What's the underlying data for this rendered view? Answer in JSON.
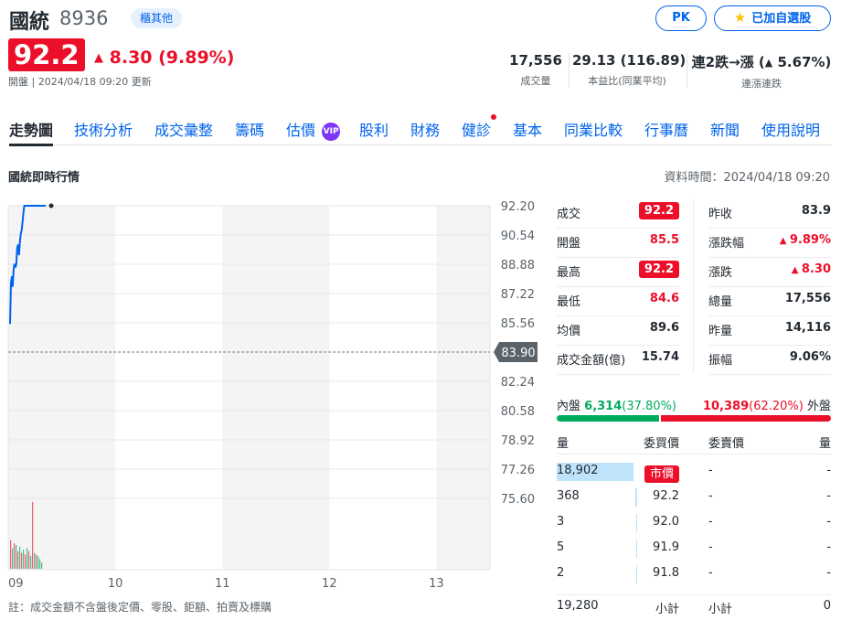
{
  "header": {
    "name": "國統",
    "code": "8936",
    "market": "櫃其他",
    "pk_label": "PK",
    "watch_label": "已加自選股",
    "price": "92.2",
    "change": "8.30 (9.89%)",
    "status": "開盤",
    "updated": "2024/04/18 09:20 更新",
    "stats": [
      {
        "value": "17,556",
        "label": "成交量"
      },
      {
        "value": "29.13 (116.89)",
        "label": "本益比(同業平均)"
      },
      {
        "value_prefix": "連2跌→漲 (",
        "value_change": "5.67%",
        "value_suffix": ")",
        "label": "連漲連跌"
      }
    ]
  },
  "tabs": [
    "走勢圖",
    "技術分析",
    "成交彙整",
    "籌碼",
    "估價",
    "股利",
    "財務",
    "健診",
    "基本",
    "同業比較",
    "行事曆",
    "新聞",
    "使用說明"
  ],
  "vip_label": "VIP",
  "section": {
    "title": "國統即時行情",
    "data_time": "資料時間：2024/04/18 09:20"
  },
  "chart_data": {
    "type": "line",
    "x_ticks": [
      "09",
      "10",
      "11",
      "12",
      "13"
    ],
    "y_ticks": [
      "92.20",
      "90.54",
      "88.88",
      "87.22",
      "85.56",
      "82.24",
      "80.58",
      "78.92",
      "77.26",
      "75.60"
    ],
    "ylim": [
      75.6,
      92.2
    ],
    "reference": 83.9,
    "reference_label": "83.90",
    "series": [
      {
        "x": [
          0,
          0.5,
          1,
          1.5,
          2,
          2.5,
          3,
          3.5,
          4,
          4.5,
          5,
          5.5,
          6,
          6.5,
          7,
          7.5,
          8,
          8.5,
          9,
          9.5,
          10,
          10.5,
          11,
          11.5,
          12,
          12.5,
          13,
          13.5,
          14,
          14.5,
          15,
          15.5,
          16,
          16.5,
          17,
          17.5,
          18,
          18.5,
          19,
          20
        ],
        "y": [
          85.5,
          87.8,
          88.2,
          87.6,
          88.6,
          88.9,
          88.7,
          88.9,
          89.8,
          90.0,
          89.4,
          90.1,
          90.6,
          90.8,
          91.3,
          91.8,
          92.2,
          92.2,
          92.2,
          92.2,
          92.2,
          92.2,
          92.2,
          92.2,
          92.2,
          92.2,
          92.2,
          92.2,
          92.2,
          92.2,
          92.2,
          92.2,
          92.2,
          92.2,
          92.2,
          92.2,
          92.2,
          92.2,
          92.2,
          92.2
        ]
      }
    ],
    "volume": [
      {
        "v": 180,
        "c": "red"
      },
      {
        "v": 130,
        "c": "green"
      },
      {
        "v": 160,
        "c": "red"
      },
      {
        "v": 150,
        "c": "green"
      },
      {
        "v": 110,
        "c": "red"
      },
      {
        "v": 140,
        "c": "green"
      },
      {
        "v": 100,
        "c": "red"
      },
      {
        "v": 120,
        "c": "green"
      },
      {
        "v": 90,
        "c": "red"
      },
      {
        "v": 130,
        "c": "green"
      },
      {
        "v": 110,
        "c": "red"
      },
      {
        "v": 80,
        "c": "green"
      },
      {
        "v": 420,
        "c": "red"
      },
      {
        "v": 100,
        "c": "green"
      },
      {
        "v": 90,
        "c": "red"
      },
      {
        "v": 80,
        "c": "green"
      },
      {
        "v": 60,
        "c": "green"
      },
      {
        "v": 40,
        "c": "green"
      }
    ]
  },
  "quote": {
    "left": [
      {
        "label": "成交",
        "value": "92.2",
        "boxed": true
      },
      {
        "label": "開盤",
        "value": "85.5",
        "color": "red"
      },
      {
        "label": "最高",
        "value": "92.2",
        "boxed": true
      },
      {
        "label": "最低",
        "value": "84.6",
        "color": "red"
      },
      {
        "label": "均價",
        "value": "89.6"
      },
      {
        "label": "成交金額(億)",
        "value": "15.74"
      }
    ],
    "right": [
      {
        "label": "昨收",
        "value": "83.9"
      },
      {
        "label": "漲跌幅",
        "value": "9.89%",
        "color": "red",
        "arrow": true
      },
      {
        "label": "漲跌",
        "value": "8.30",
        "color": "red",
        "arrow": true
      },
      {
        "label": "總量",
        "value": "17,556"
      },
      {
        "label": "昨量",
        "value": "14,116"
      },
      {
        "label": "振幅",
        "value": "9.06%"
      }
    ]
  },
  "flow": {
    "inner_label": "內盤",
    "inner_value": "6,314",
    "inner_pct": "(37.80%)",
    "outer_value": "10,389",
    "outer_pct": "(62.20%)",
    "outer_label": "外盤",
    "inner_ratio": 0.378
  },
  "book": {
    "headers": [
      "量",
      "委買價",
      "委賣價",
      "量"
    ],
    "rows": [
      {
        "bid_vol": "18,902",
        "bid_price": "市價",
        "market": true,
        "ask_price": "-",
        "ask_vol": "-",
        "bar": 0.95
      },
      {
        "bid_vol": "368",
        "bid_price": "92.2",
        "ask_price": "-",
        "ask_vol": "-",
        "bar": 0.02
      },
      {
        "bid_vol": "3",
        "bid_price": "92.0",
        "ask_price": "-",
        "ask_vol": "-",
        "bar": 0.0
      },
      {
        "bid_vol": "5",
        "bid_price": "91.9",
        "ask_price": "-",
        "ask_vol": "-",
        "bar": 0.01
      },
      {
        "bid_vol": "2",
        "bid_price": "91.8",
        "ask_price": "-",
        "ask_vol": "-",
        "bar": 0.0
      }
    ],
    "total_bid": "19,280",
    "subtotal_label": "小計",
    "total_ask": "0"
  },
  "note": "註：成交金額不含盤後定價、零股、鉅額、拍賣及標購"
}
